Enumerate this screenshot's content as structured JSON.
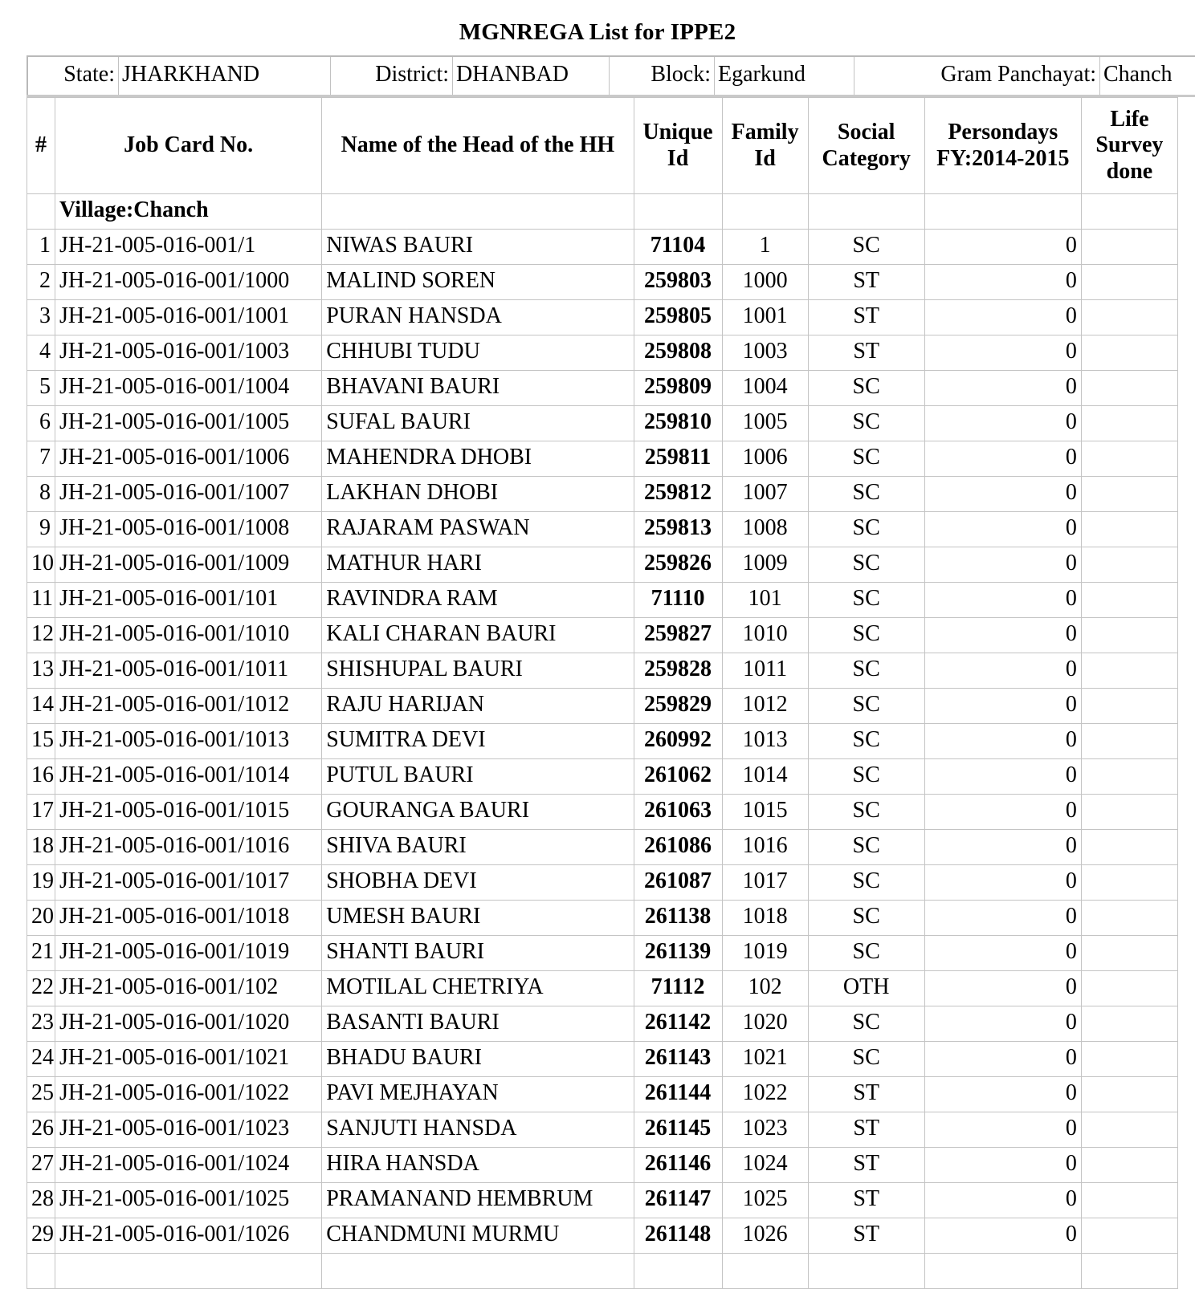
{
  "title": "MGNREGA List for IPPE2",
  "location": {
    "state_label": "State:",
    "state_value": "JHARKHAND",
    "district_label": "District:",
    "district_value": "DHANBAD",
    "block_label": "Block:",
    "block_value": "Egarkund",
    "panchayat_label": "Gram Panchayat:",
    "panchayat_value": "Chanch"
  },
  "columns": {
    "index": "#",
    "job_card": "Job Card No.",
    "name": "Name of the Head of the HH",
    "unique_id": "Unique Id",
    "family_id": "Family Id",
    "social_category": "Social Category",
    "persondays": "Persondays FY:2014-2015",
    "life_survey": "Life Survey done"
  },
  "village_row": {
    "label": "Village:Chanch"
  },
  "rows": [
    {
      "idx": "1",
      "card": "JH-21-005-016-001/1",
      "name": "NIWAS BAURI",
      "uid": "71104",
      "fid": "1",
      "cat": "SC",
      "days": "0",
      "life": ""
    },
    {
      "idx": "2",
      "card": "JH-21-005-016-001/1000",
      "name": "MALIND SOREN",
      "uid": "259803",
      "fid": "1000",
      "cat": "ST",
      "days": "0",
      "life": ""
    },
    {
      "idx": "3",
      "card": "JH-21-005-016-001/1001",
      "name": "PURAN HANSDA",
      "uid": "259805",
      "fid": "1001",
      "cat": "ST",
      "days": "0",
      "life": ""
    },
    {
      "idx": "4",
      "card": "JH-21-005-016-001/1003",
      "name": "CHHUBI TUDU",
      "uid": "259808",
      "fid": "1003",
      "cat": "ST",
      "days": "0",
      "life": ""
    },
    {
      "idx": "5",
      "card": "JH-21-005-016-001/1004",
      "name": "BHAVANI BAURI",
      "uid": "259809",
      "fid": "1004",
      "cat": "SC",
      "days": "0",
      "life": ""
    },
    {
      "idx": "6",
      "card": "JH-21-005-016-001/1005",
      "name": "SUFAL BAURI",
      "uid": "259810",
      "fid": "1005",
      "cat": "SC",
      "days": "0",
      "life": ""
    },
    {
      "idx": "7",
      "card": "JH-21-005-016-001/1006",
      "name": "MAHENDRA DHOBI",
      "uid": "259811",
      "fid": "1006",
      "cat": "SC",
      "days": "0",
      "life": ""
    },
    {
      "idx": "8",
      "card": "JH-21-005-016-001/1007",
      "name": "LAKHAN DHOBI",
      "uid": "259812",
      "fid": "1007",
      "cat": "SC",
      "days": "0",
      "life": ""
    },
    {
      "idx": "9",
      "card": "JH-21-005-016-001/1008",
      "name": "RAJARAM PASWAN",
      "uid": "259813",
      "fid": "1008",
      "cat": "SC",
      "days": "0",
      "life": ""
    },
    {
      "idx": "10",
      "card": "JH-21-005-016-001/1009",
      "name": "MATHUR HARI",
      "uid": "259826",
      "fid": "1009",
      "cat": "SC",
      "days": "0",
      "life": ""
    },
    {
      "idx": "11",
      "card": "JH-21-005-016-001/101",
      "name": "RAVINDRA RAM",
      "uid": "71110",
      "fid": "101",
      "cat": "SC",
      "days": "0",
      "life": ""
    },
    {
      "idx": "12",
      "card": "JH-21-005-016-001/1010",
      "name": "KALI CHARAN BAURI",
      "uid": "259827",
      "fid": "1010",
      "cat": "SC",
      "days": "0",
      "life": ""
    },
    {
      "idx": "13",
      "card": "JH-21-005-016-001/1011",
      "name": "SHISHUPAL BAURI",
      "uid": "259828",
      "fid": "1011",
      "cat": "SC",
      "days": "0",
      "life": ""
    },
    {
      "idx": "14",
      "card": "JH-21-005-016-001/1012",
      "name": "RAJU HARIJAN",
      "uid": "259829",
      "fid": "1012",
      "cat": "SC",
      "days": "0",
      "life": ""
    },
    {
      "idx": "15",
      "card": "JH-21-005-016-001/1013",
      "name": "SUMITRA DEVI",
      "uid": "260992",
      "fid": "1013",
      "cat": "SC",
      "days": "0",
      "life": ""
    },
    {
      "idx": "16",
      "card": "JH-21-005-016-001/1014",
      "name": "PUTUL BAURI",
      "uid": "261062",
      "fid": "1014",
      "cat": "SC",
      "days": "0",
      "life": ""
    },
    {
      "idx": "17",
      "card": "JH-21-005-016-001/1015",
      "name": "GOURANGA BAURI",
      "uid": "261063",
      "fid": "1015",
      "cat": "SC",
      "days": "0",
      "life": ""
    },
    {
      "idx": "18",
      "card": "JH-21-005-016-001/1016",
      "name": "SHIVA BAURI",
      "uid": "261086",
      "fid": "1016",
      "cat": "SC",
      "days": "0",
      "life": ""
    },
    {
      "idx": "19",
      "card": "JH-21-005-016-001/1017",
      "name": "SHOBHA DEVI",
      "uid": "261087",
      "fid": "1017",
      "cat": "SC",
      "days": "0",
      "life": ""
    },
    {
      "idx": "20",
      "card": "JH-21-005-016-001/1018",
      "name": "UMESH BAURI",
      "uid": "261138",
      "fid": "1018",
      "cat": "SC",
      "days": "0",
      "life": ""
    },
    {
      "idx": "21",
      "card": "JH-21-005-016-001/1019",
      "name": "SHANTI BAURI",
      "uid": "261139",
      "fid": "1019",
      "cat": "SC",
      "days": "0",
      "life": ""
    },
    {
      "idx": "22",
      "card": "JH-21-005-016-001/102",
      "name": "MOTILAL CHETRIYA",
      "uid": "71112",
      "fid": "102",
      "cat": "OTH",
      "days": "0",
      "life": ""
    },
    {
      "idx": "23",
      "card": "JH-21-005-016-001/1020",
      "name": "BASANTI BAURI",
      "uid": "261142",
      "fid": "1020",
      "cat": "SC",
      "days": "0",
      "life": ""
    },
    {
      "idx": "24",
      "card": "JH-21-005-016-001/1021",
      "name": "BHADU BAURI",
      "uid": "261143",
      "fid": "1021",
      "cat": "SC",
      "days": "0",
      "life": ""
    },
    {
      "idx": "25",
      "card": "JH-21-005-016-001/1022",
      "name": "PAVI MEJHAYAN",
      "uid": "261144",
      "fid": "1022",
      "cat": "ST",
      "days": "0",
      "life": ""
    },
    {
      "idx": "26",
      "card": "JH-21-005-016-001/1023",
      "name": "SANJUTI HANSDA",
      "uid": "261145",
      "fid": "1023",
      "cat": "ST",
      "days": "0",
      "life": ""
    },
    {
      "idx": "27",
      "card": "JH-21-005-016-001/1024",
      "name": "HIRA HANSDA",
      "uid": "261146",
      "fid": "1024",
      "cat": "ST",
      "days": "0",
      "life": ""
    },
    {
      "idx": "28",
      "card": "JH-21-005-016-001/1025",
      "name": "PRAMANAND HEMBRUM",
      "uid": "261147",
      "fid": "1025",
      "cat": "ST",
      "days": "0",
      "life": ""
    },
    {
      "idx": "29",
      "card": "JH-21-005-016-001/1026",
      "name": "CHANDMUNI MURMU",
      "uid": "261148",
      "fid": "1026",
      "cat": "ST",
      "days": "0",
      "life": ""
    },
    {
      "idx": "",
      "card": "",
      "name": "",
      "uid": "",
      "fid": "",
      "cat": "",
      "days": "",
      "life": ""
    }
  ]
}
